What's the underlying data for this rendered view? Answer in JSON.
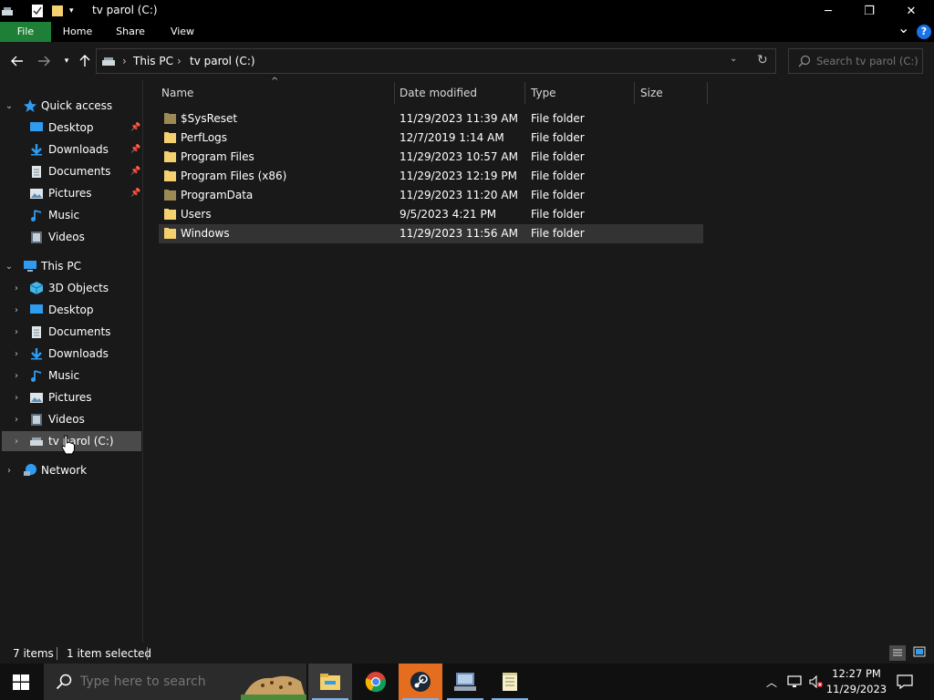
{
  "window": {
    "title": "tv parol (C:)",
    "minimize_label": "─",
    "restore_label": "❐",
    "close_label": "✕"
  },
  "ribbon": {
    "tabs": [
      {
        "label": "File"
      },
      {
        "label": "Home"
      },
      {
        "label": "Share"
      },
      {
        "label": "View"
      }
    ],
    "expand_glyph": "⌄",
    "help_glyph": "?"
  },
  "address": {
    "crumbs": [
      "This PC",
      "tv parol (C:)"
    ],
    "separator": "›"
  },
  "search": {
    "placeholder": "Search tv parol (C:)"
  },
  "nav": {
    "quick_access": {
      "label": "Quick access",
      "items": [
        {
          "label": "Desktop",
          "icon": "desktop-icon",
          "pinned": true
        },
        {
          "label": "Downloads",
          "icon": "downloads-icon",
          "pinned": true
        },
        {
          "label": "Documents",
          "icon": "documents-icon",
          "pinned": true
        },
        {
          "label": "Pictures",
          "icon": "pictures-icon",
          "pinned": true
        },
        {
          "label": "Music",
          "icon": "music-icon",
          "pinned": false
        },
        {
          "label": "Videos",
          "icon": "videos-icon",
          "pinned": false
        }
      ]
    },
    "this_pc": {
      "label": "This PC",
      "items": [
        {
          "label": "3D Objects",
          "icon": "3d-objects-icon"
        },
        {
          "label": "Desktop",
          "icon": "desktop-icon"
        },
        {
          "label": "Documents",
          "icon": "documents-icon"
        },
        {
          "label": "Downloads",
          "icon": "downloads-icon"
        },
        {
          "label": "Music",
          "icon": "music-icon"
        },
        {
          "label": "Pictures",
          "icon": "pictures-icon"
        },
        {
          "label": "Videos",
          "icon": "videos-icon"
        },
        {
          "label": "tv parol (C:)",
          "icon": "drive-icon",
          "selected": true
        }
      ]
    },
    "network": {
      "label": "Network"
    }
  },
  "columns": [
    "Name",
    "Date modified",
    "Type",
    "Size"
  ],
  "files": [
    {
      "name": "$SysReset",
      "modified": "11/29/2023 11:39 AM",
      "type": "File folder",
      "size": "",
      "hidden": true
    },
    {
      "name": "PerfLogs",
      "modified": "12/7/2019 1:14 AM",
      "type": "File folder",
      "size": "",
      "hidden": false
    },
    {
      "name": "Program Files",
      "modified": "11/29/2023 10:57 AM",
      "type": "File folder",
      "size": "",
      "hidden": false
    },
    {
      "name": "Program Files (x86)",
      "modified": "11/29/2023 12:19 PM",
      "type": "File folder",
      "size": "",
      "hidden": false
    },
    {
      "name": "ProgramData",
      "modified": "11/29/2023 11:20 AM",
      "type": "File folder",
      "size": "",
      "hidden": true
    },
    {
      "name": "Users",
      "modified": "9/5/2023 4:21 PM",
      "type": "File folder",
      "size": "",
      "hidden": false
    },
    {
      "name": "Windows",
      "modified": "11/29/2023 11:56 AM",
      "type": "File folder",
      "size": "",
      "hidden": false,
      "selected": true
    }
  ],
  "status": {
    "item_count": "7 items",
    "selection": "1 item selected"
  },
  "taskbar": {
    "search_placeholder": "Type here to search",
    "time": "12:27 PM",
    "date": "11/29/2023"
  },
  "colors": {
    "accent_file_tab": "#1e7f36",
    "folder": "#f4d06f",
    "folder_hidden": "#9c8a55",
    "selection": "#4a4a4a",
    "help": "#1a73e8"
  }
}
